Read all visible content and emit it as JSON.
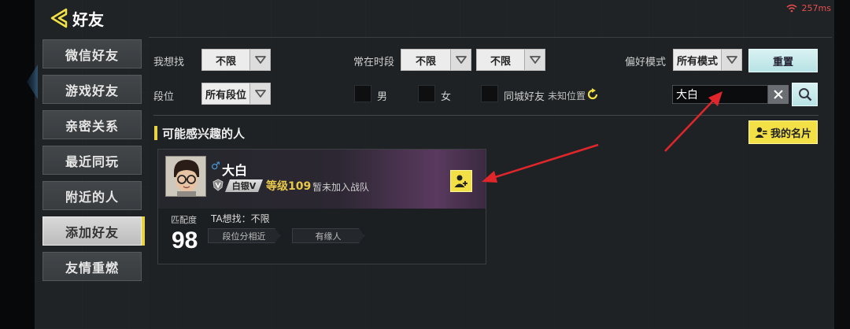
{
  "header": {
    "title": "好友",
    "ping": "257ms"
  },
  "sidebar": {
    "items": [
      {
        "label": "微信好友",
        "active": false
      },
      {
        "label": "游戏好友",
        "active": false
      },
      {
        "label": "亲密关系",
        "active": false
      },
      {
        "label": "最近同玩",
        "active": false
      },
      {
        "label": "附近的人",
        "active": false
      },
      {
        "label": "添加好友",
        "active": true
      },
      {
        "label": "友情重燃",
        "active": false
      }
    ]
  },
  "filters": {
    "want_label": "我想找",
    "want_value": "不限",
    "time_label": "常在时段",
    "time_value_1": "不限",
    "time_value_2": "不限",
    "mode_label": "偏好模式",
    "mode_value": "所有模式",
    "reset_label": "重置",
    "rank_label": "段位",
    "rank_value": "所有段位",
    "male_label": "男",
    "female_label": "女",
    "same_city_label": "同城好友",
    "location_note": "未知位置",
    "search_value": "大白"
  },
  "section": {
    "title": "可能感兴趣的人",
    "my_card_label": "我的名片"
  },
  "friend": {
    "gender_symbol": "♂",
    "name": "大白",
    "rank": "白银Ⅴ",
    "level": "等级109",
    "team_status": "暂未加入战队",
    "match_label": "匹配度",
    "match_score": "98",
    "wants": "TA想找：不限",
    "tags": [
      "段位分相近",
      "有缘人"
    ]
  },
  "colors": {
    "accent_yellow": "#f2e046",
    "ping_red": "#e84e4e",
    "arrow_red": "#e0262a",
    "reset_cyan": "#c6eaec"
  }
}
